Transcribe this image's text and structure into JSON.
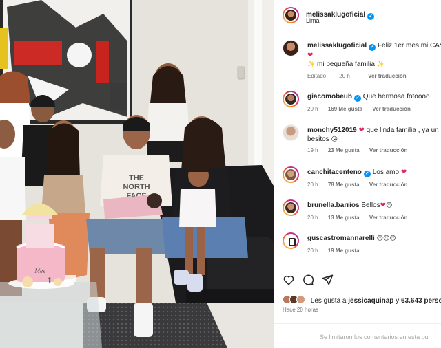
{
  "post_author": {
    "username": "melissaklugoficial",
    "location": "Lima"
  },
  "caption": {
    "username": "melissaklugoficial",
    "text_line1": "Feliz 1er mes mi CAY",
    "text_line2": "mi pequeña familia",
    "edited": "Editado",
    "age": "20 h",
    "translate": "Ver traducción"
  },
  "comments": [
    {
      "username": "giacomobeub",
      "verified": true,
      "text": "Que hermosa fotoooo",
      "age": "20 h",
      "likes": "169 Me gusta",
      "translate": "Ver traducción"
    },
    {
      "username": "monchy512019",
      "verified": false,
      "text": "que linda familia , ya un",
      "text2": "besitos",
      "age": "19 h",
      "likes": "23 Me gusta",
      "translate": "Ver traducción"
    },
    {
      "username": "canchitacenteno",
      "verified": true,
      "text": "Los amo",
      "age": "20 h",
      "likes": "78 Me gusta",
      "translate": "Ver traducción"
    },
    {
      "username": "brunella.barrios",
      "verified": false,
      "text": "Bellos",
      "age": "20 h",
      "likes": "13 Me gusta",
      "translate": "Ver traducción"
    },
    {
      "username": "guscastromannarelli",
      "verified": false,
      "text": "",
      "age": "20 h",
      "likes": "19 Me gusta",
      "translate": ""
    }
  ],
  "likes_summary": {
    "prefix": "Les gusta a",
    "first_user": "jessicaquinap",
    "middle": "y",
    "others": "63.643 perso"
  },
  "post_time": "Hace 20 horas",
  "comments_limited": "Se limitaron los comentarios en esta pu",
  "colors": {
    "verified": "#0095f6",
    "heart": "#e0245e",
    "muted": "#737373"
  },
  "cake_topper": "1",
  "cake_banner": "Mes"
}
